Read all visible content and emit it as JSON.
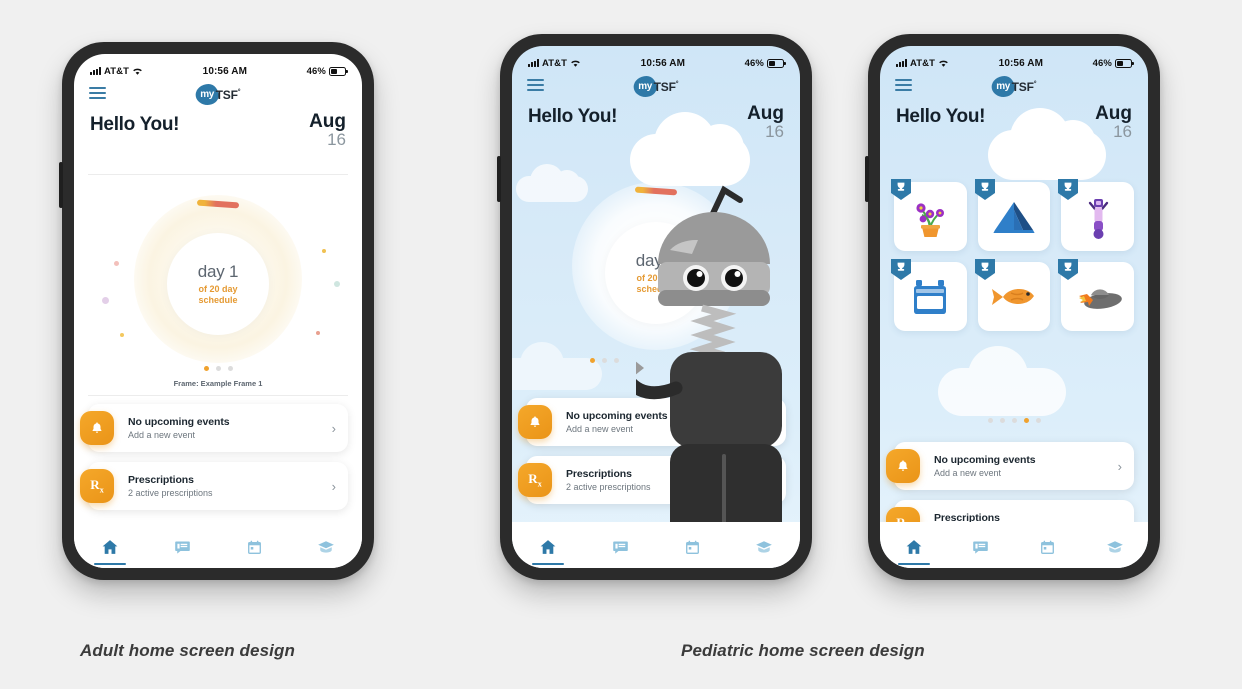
{
  "page": {
    "background": "#f0f0f0",
    "captions": [
      {
        "text": "Adult home screen design"
      },
      {
        "text": "Pediatric home screen design"
      }
    ]
  },
  "status_bar": {
    "carrier": "AT&T",
    "time": "10:56 AM",
    "battery": "46%",
    "signal_icon": "signal-bars-icon",
    "wifi_icon": "wifi-icon",
    "battery_icon": "battery-icon"
  },
  "app_bar": {
    "menu_icon": "hamburger-menu-icon",
    "logo_mark": "my",
    "logo_text": "TSF",
    "logo_degree": "°"
  },
  "greeting": {
    "title": "Hello You!",
    "month": "Aug",
    "day": "16"
  },
  "progress": {
    "day_label": "day 1",
    "schedule_line1": "of 20 day",
    "schedule_line2": "schedule",
    "ring_color": "#fbf4e2",
    "arc_color": "#e2715e",
    "accent_color": "#e59a33"
  },
  "pager": {
    "adult": {
      "count": 3,
      "active": 0
    },
    "pediatric_ring": {
      "count": 3,
      "active": 0
    },
    "pediatric_badges": {
      "count": 5,
      "active": 3
    },
    "frame_label": "Frame: Example Frame 1",
    "active_color": "#f0a22e",
    "inactive_color": "#dcdcdc"
  },
  "cards": [
    {
      "icon": "bell-icon",
      "title": "No upcoming events",
      "subtitle": "Add a new event",
      "chevron": "›"
    },
    {
      "icon": "prescription-rx-icon",
      "title": "Prescriptions",
      "subtitle": "2 active prescriptions",
      "chevron": "›"
    }
  ],
  "tabbar": {
    "accent_color": "#2e79a8",
    "inactive_color": "#8ec2dd",
    "items": [
      {
        "name": "home-tab",
        "icon": "home-icon",
        "active": true
      },
      {
        "name": "messages-tab",
        "icon": "message-list-icon",
        "active": false
      },
      {
        "name": "calendar-tab",
        "icon": "calendar-icon",
        "active": false
      },
      {
        "name": "education-tab",
        "icon": "graduation-cap-icon",
        "active": false
      }
    ]
  },
  "badges": [
    {
      "name": "badge-flower-pot",
      "icon": "flower-pot-icon",
      "trophy": "trophy-ribbon-icon"
    },
    {
      "name": "badge-tent",
      "icon": "tent-icon",
      "trophy": "trophy-ribbon-icon"
    },
    {
      "name": "badge-telescope",
      "icon": "telescope-icon",
      "trophy": "trophy-ribbon-icon"
    },
    {
      "name": "badge-stove",
      "icon": "stove-icon",
      "trophy": "trophy-ribbon-icon"
    },
    {
      "name": "badge-fish",
      "icon": "fish-icon",
      "trophy": "trophy-ribbon-icon"
    },
    {
      "name": "badge-rocket",
      "icon": "rocket-icon",
      "trophy": "trophy-ribbon-icon"
    }
  ],
  "mascot": {
    "name": "robot-mascot",
    "icon": "robot-icon"
  },
  "theme": {
    "sky_top": "#cfe6f7",
    "sky_bottom": "#e6f3fc",
    "cloud": "#ffffff",
    "brand_blue": "#2e79a8",
    "orange": "#f0a22e"
  }
}
